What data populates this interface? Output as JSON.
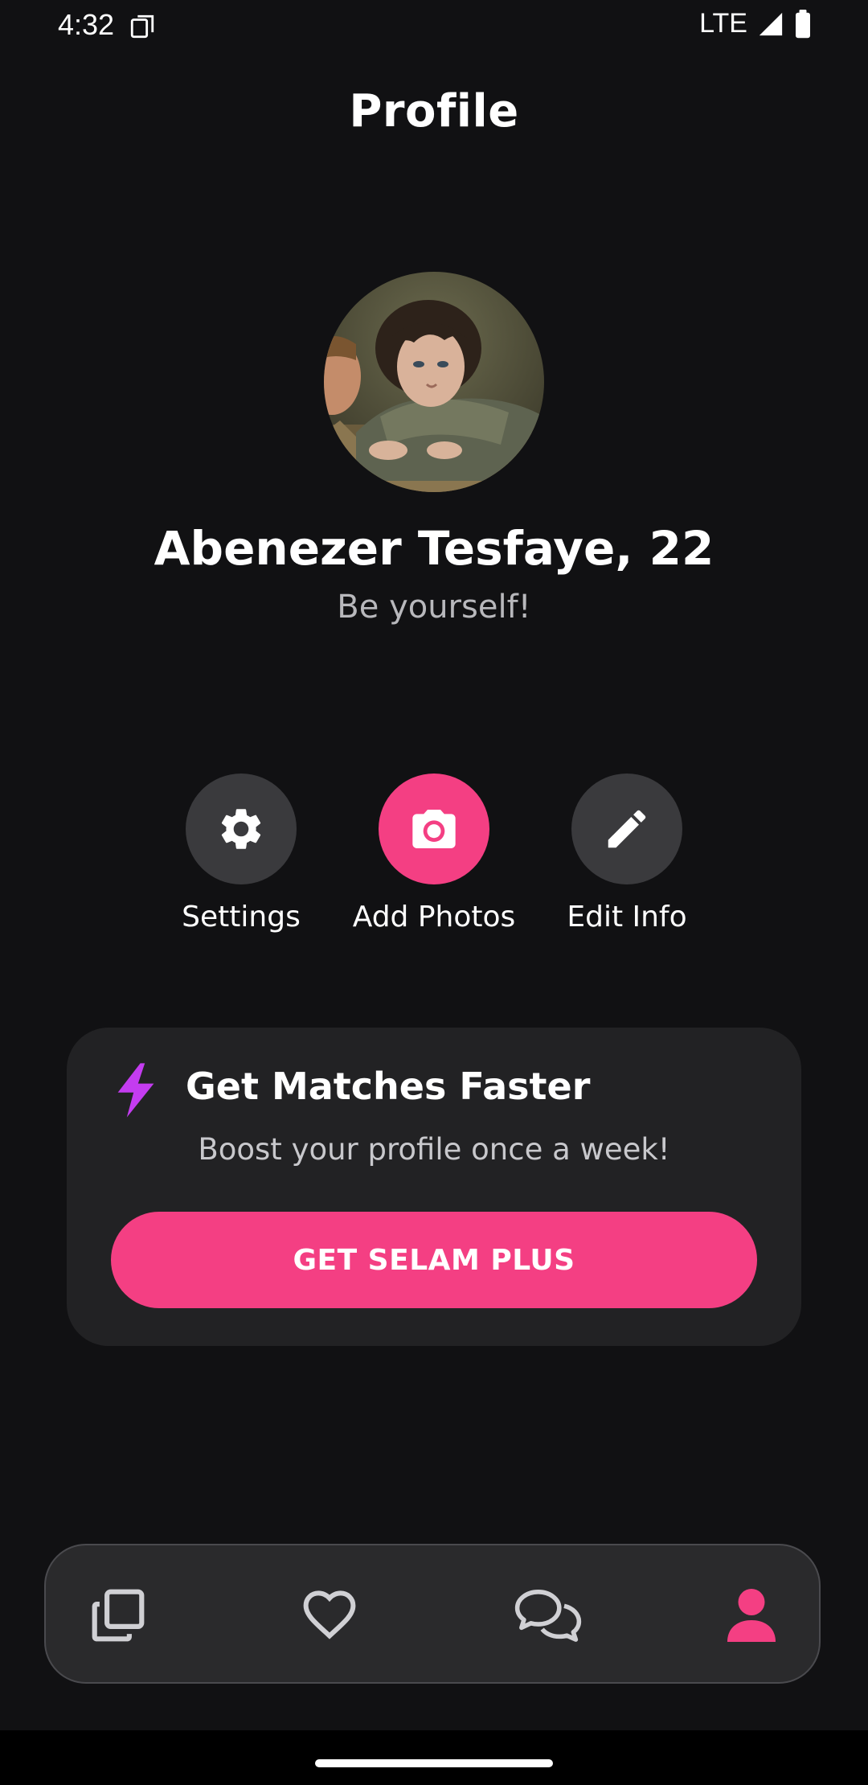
{
  "status_bar": {
    "time": "4:32",
    "network": "LTE",
    "icons": [
      "sim-card-icon",
      "signal-icon",
      "battery-icon"
    ]
  },
  "header": {
    "title": "Profile"
  },
  "profile": {
    "name": "Abenezer Tesfaye, 22",
    "bio": "Be yourself!",
    "avatar_icon": "avatar-photo"
  },
  "actions": [
    {
      "label": "Settings",
      "icon": "gear-icon",
      "color": "#3a3a3d"
    },
    {
      "label": "Add Photos",
      "icon": "camera-icon",
      "color": "#f43f83"
    },
    {
      "label": "Edit Info",
      "icon": "pencil-icon",
      "color": "#3a3a3d"
    }
  ],
  "boost": {
    "title": "Get Matches Faster",
    "subtitle": "Boost your profile once a week!",
    "button_label": "GET SELAM PLUS",
    "icon": "lightning-icon",
    "icon_color": "#c43cf0"
  },
  "bottom_nav": {
    "items": [
      {
        "icon": "cards-icon",
        "active": false
      },
      {
        "icon": "heart-icon",
        "active": false
      },
      {
        "icon": "chat-icon",
        "active": false
      },
      {
        "icon": "person-icon",
        "active": true
      }
    ]
  },
  "colors": {
    "background": "#111113",
    "accent": "#f43f83",
    "card": "#222224",
    "inactive_icon": "#d0d0d4"
  }
}
